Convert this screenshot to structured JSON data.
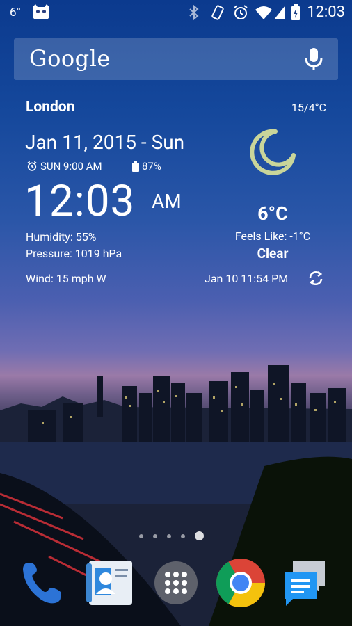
{
  "status_bar": {
    "temp_indicator": "6°",
    "time": "12:03",
    "icons": [
      "cyanogen-icon",
      "bluetooth-icon",
      "vibrate-icon",
      "alarm-icon",
      "wifi-icon",
      "signal-icon",
      "battery-charging-icon"
    ]
  },
  "search": {
    "brand": "Google",
    "mic_icon": "mic-icon"
  },
  "widget": {
    "city": "London",
    "hi_lo": "15/4°C",
    "date": "Jan 11, 2015 - Sun",
    "alarm": "SUN 9:00 AM",
    "battery": "87%",
    "time": "12:03",
    "ampm": "AM",
    "humidity": "Humidity: 55%",
    "pressure": "Pressure: 1019 hPa",
    "wind": "Wind: 15 mph W",
    "temperature": "6°C",
    "feels_like": "Feels Like: -1°C",
    "condition": "Clear",
    "updated": "Jan 10   11:54 PM",
    "condition_icon": "moon-icon"
  },
  "page_dots": {
    "count": 5,
    "active_index": 4
  },
  "dock": [
    {
      "name": "phone",
      "icon": "phone-icon"
    },
    {
      "name": "contacts",
      "icon": "contacts-icon"
    },
    {
      "name": "apps",
      "icon": "app-drawer-icon"
    },
    {
      "name": "chrome",
      "icon": "chrome-icon"
    },
    {
      "name": "messaging",
      "icon": "messaging-icon"
    }
  ],
  "colors": {
    "moon": "#c9d59a",
    "phone_blue": "#2c73d6",
    "messaging_blue": "#2196f3"
  }
}
